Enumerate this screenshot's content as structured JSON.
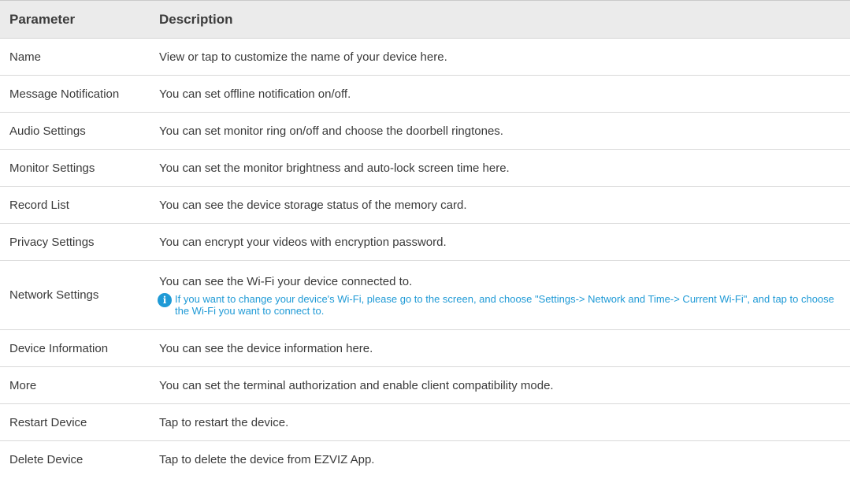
{
  "table": {
    "headers": {
      "parameter": "Parameter",
      "description": "Description"
    },
    "rows": [
      {
        "parameter": "Name",
        "description": "View or tap to customize the name of your device here."
      },
      {
        "parameter": "Message Notification",
        "description": "You can set offline notification on/off."
      },
      {
        "parameter": "Audio Settings",
        "description": "You can set monitor ring on/off and choose the doorbell ringtones."
      },
      {
        "parameter": "Monitor Settings",
        "description": "You can set the monitor brightness and auto-lock screen time here."
      },
      {
        "parameter": "Record List",
        "description": "You can see the device storage status of the memory card."
      },
      {
        "parameter": "Privacy Settings",
        "description": "You can encrypt your videos with encryption password."
      },
      {
        "parameter": "Network Settings",
        "description": "You can see the Wi-Fi your device connected to.",
        "note": "If you want to change your device's Wi-Fi, please go to the screen, and choose \"Settings-> Network and Time-> Current Wi-Fi\", and tap to choose the Wi-Fi you want to connect to.",
        "note_icon": "info-icon"
      },
      {
        "parameter": "Device Information",
        "description": "You can see the device information here."
      },
      {
        "parameter": "More",
        "description": "You can set the terminal authorization and enable client compatibility mode."
      },
      {
        "parameter": "Restart Device",
        "description": "Tap to restart the device."
      },
      {
        "parameter": "Delete Device",
        "description": "Tap to delete the device from EZVIZ App."
      }
    ]
  },
  "colors": {
    "header_background": "#ebebeb",
    "note_accent": "#1f9ad6",
    "text": "#3a3a3a"
  }
}
